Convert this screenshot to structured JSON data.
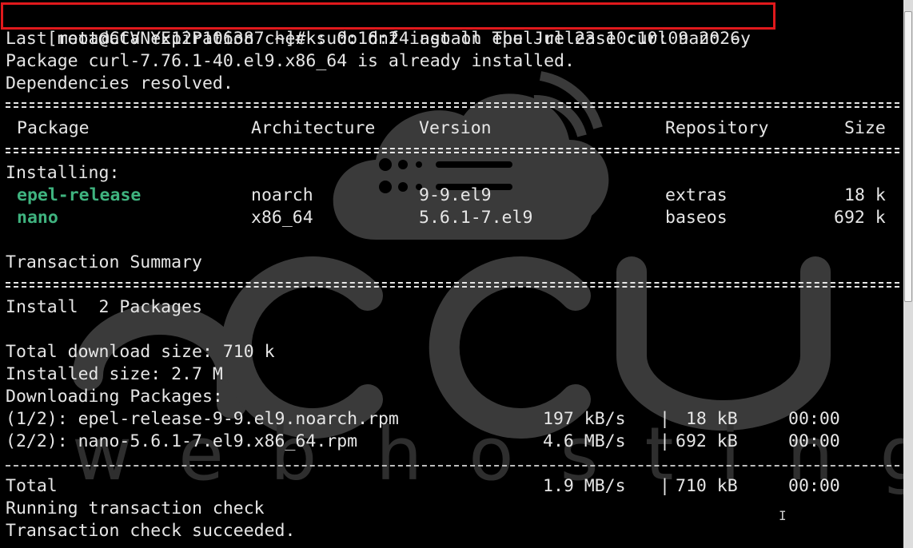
{
  "command": {
    "prompt": "[root@CCVNYE12P106387 ~]#",
    "text": " sudo dnf install epel-release curl nano -y"
  },
  "header_lines": [
    "Last metadata expiration check: 0:16:24 ago on Thu Jul 23 10:10:09 2026.",
    "Package curl-7.76.1-40.el9.x86_64 is already installed.",
    "Dependencies resolved."
  ],
  "table": {
    "columns": [
      "Package",
      "Architecture",
      "Version",
      "Repository",
      "Size"
    ],
    "section_label": "Installing:",
    "rows": [
      {
        "package": "epel-release",
        "arch": "noarch",
        "version": "9-9.el9",
        "repo": "extras",
        "size": "18 k"
      },
      {
        "package": "nano",
        "arch": "x86_64",
        "version": "5.6.1-7.el9",
        "repo": "baseos",
        "size": "692 k"
      }
    ]
  },
  "summary": {
    "title": "Transaction Summary",
    "install_line": "Install  2 Packages",
    "download_size": "Total download size: 710 k",
    "installed_size": "Installed size: 2.7 M",
    "downloading": "Downloading Packages:"
  },
  "downloads": [
    {
      "name": "(1/2): epel-release-9-9.el9.noarch.rpm",
      "speed": "197 kB/s",
      "size": " 18 kB",
      "time": "00:00"
    },
    {
      "name": "(2/2): nano-5.6.1-7.el9.x86_64.rpm",
      "speed": "4.6 MB/s",
      "size": "692 kB",
      "time": "00:00"
    }
  ],
  "total": {
    "label": "Total",
    "speed": "1.9 MB/s",
    "size": "710 kB",
    "time": "00:00"
  },
  "footer_lines": [
    "Running transaction check",
    "Transaction check succeeded."
  ],
  "watermark": {
    "brand": "accu",
    "tagline": "web hosting"
  },
  "colors": {
    "text": "#e6e6e6",
    "package_green": "#3fb37f",
    "highlight_red": "#e0191c",
    "background": "#000000"
  }
}
